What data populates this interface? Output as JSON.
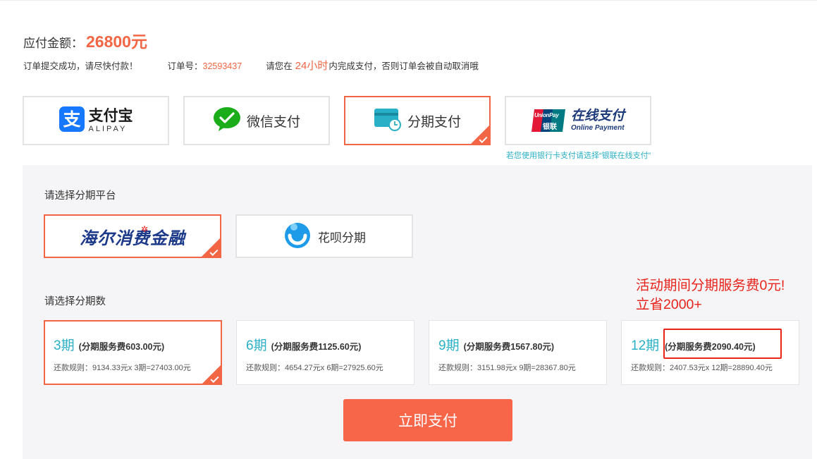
{
  "order": {
    "amount_label": "应付金额：",
    "amount_value": "26800元",
    "submit_msg": "订单提交成功，请尽快付款！",
    "order_no_label": "订单号：",
    "order_no": "32593437",
    "deadline_pre": "请您在",
    "deadline_time": "24小时",
    "deadline_post": "内完成支付，否则订单会被自动取消哦"
  },
  "payment_methods": [
    {
      "id": "alipay",
      "cn": "支付宝",
      "en": "ALIPAY",
      "selected": false
    },
    {
      "id": "wechat",
      "label": "微信支付",
      "selected": false
    },
    {
      "id": "installment",
      "label": "分期支付",
      "selected": true
    },
    {
      "id": "unionpay",
      "logo_en": "UnionPay",
      "logo_cn": "银联",
      "cn": "在线支付",
      "en": "Online Payment",
      "selected": false
    }
  ],
  "unionpay_hint": "若您使用银行卡支付请选择“银联在线支付”",
  "platform_section": {
    "label": "请选择分期平台",
    "platforms": [
      {
        "id": "haier",
        "label": "海尔消费金融",
        "selected": true
      },
      {
        "id": "huabei",
        "label": "花呗分期",
        "selected": false
      }
    ]
  },
  "term_section": {
    "label": "请选择分期数",
    "promo_line1": "活动期间分期服务费0元!",
    "promo_line2": "立省2000+",
    "terms": [
      {
        "n": "3期",
        "fee": "(分期服务费603.00元)",
        "rule": "还款规则：9134.33元x 3期=27403.00元",
        "selected": true
      },
      {
        "n": "6期",
        "fee": "(分期服务费1125.60元)",
        "rule": "还款规则：4654.27元x 6期=27925.60元",
        "selected": false
      },
      {
        "n": "9期",
        "fee": "(分期服务费1567.80元)",
        "rule": "还款规则：3151.98元x 9期=28367.80元",
        "selected": false
      },
      {
        "n": "12期",
        "fee": "(分期服务费2090.40元)",
        "rule": "还款规则：2407.53元x 12期=28890.40元",
        "selected": false
      }
    ]
  },
  "pay_button": "立即支付",
  "colors": {
    "accent": "#f26645",
    "teal": "#2ab0c6",
    "promo_red": "#e8231a",
    "alipay_blue": "#1677ff",
    "wechat_green": "#1aad19"
  }
}
